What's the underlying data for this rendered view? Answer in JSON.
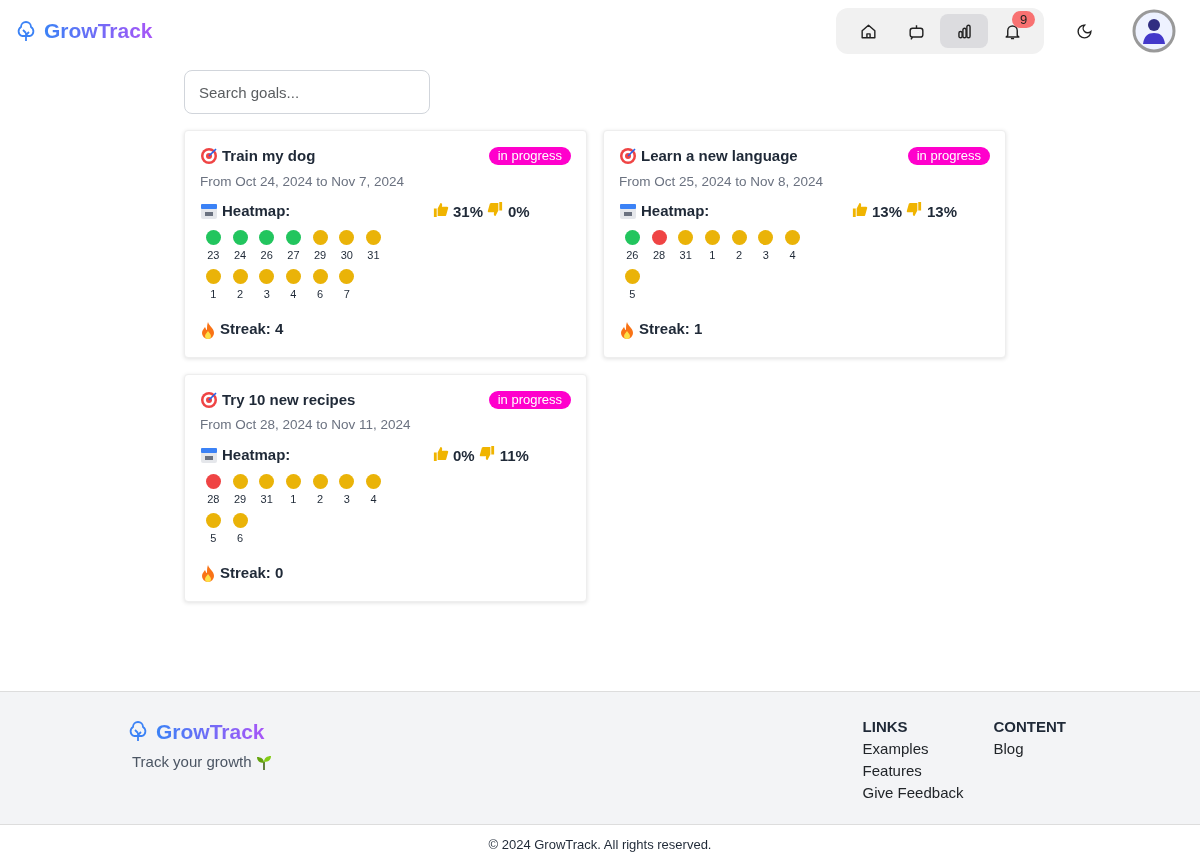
{
  "brand": "GrowTrack",
  "nav": [
    {
      "kind": "home",
      "selected": false
    },
    {
      "kind": "bot",
      "selected": false
    },
    {
      "kind": "chart",
      "selected": true
    },
    {
      "kind": "bell",
      "selected": false,
      "badge": "9"
    }
  ],
  "search": {
    "placeholder": "Search goals..."
  },
  "goals": [
    {
      "title": "Train my dog",
      "status": "in progress",
      "dates": "From Oct 24, 2024 to Nov 7, 2024",
      "heatmap_label": "Heatmap:",
      "up": "31%",
      "down": "0%",
      "streak": "Streak: 4",
      "days": [
        {
          "label": "23",
          "color": "#22c55e"
        },
        {
          "label": "24",
          "color": "#22c55e"
        },
        {
          "label": "26",
          "color": "#22c55e"
        },
        {
          "label": "27",
          "color": "#22c55e"
        },
        {
          "label": "29",
          "color": "#eab308"
        },
        {
          "label": "30",
          "color": "#eab308"
        },
        {
          "label": "31",
          "color": "#eab308"
        },
        {
          "label": "1",
          "color": "#eab308"
        },
        {
          "label": "2",
          "color": "#eab308"
        },
        {
          "label": "3",
          "color": "#eab308"
        },
        {
          "label": "4",
          "color": "#eab308"
        },
        {
          "label": "6",
          "color": "#eab308"
        },
        {
          "label": "7",
          "color": "#eab308"
        }
      ]
    },
    {
      "title": "Learn a new language",
      "status": "in progress",
      "dates": "From Oct 25, 2024 to Nov 8, 2024",
      "heatmap_label": "Heatmap:",
      "up": "13%",
      "down": "13%",
      "streak": "Streak: 1",
      "days": [
        {
          "label": "26",
          "color": "#22c55e"
        },
        {
          "label": "28",
          "color": "#ef4444"
        },
        {
          "label": "31",
          "color": "#eab308"
        },
        {
          "label": "1",
          "color": "#eab308"
        },
        {
          "label": "2",
          "color": "#eab308"
        },
        {
          "label": "3",
          "color": "#eab308"
        },
        {
          "label": "4",
          "color": "#eab308"
        },
        {
          "label": "5",
          "color": "#eab308"
        }
      ]
    },
    {
      "title": "Try 10 new recipes",
      "status": "in progress",
      "dates": "From Oct 28, 2024 to Nov 11, 2024",
      "heatmap_label": "Heatmap:",
      "up": "0%",
      "down": "11%",
      "streak": "Streak: 0",
      "days": [
        {
          "label": "28",
          "color": "#ef4444"
        },
        {
          "label": "29",
          "color": "#eab308"
        },
        {
          "label": "31",
          "color": "#eab308"
        },
        {
          "label": "1",
          "color": "#eab308"
        },
        {
          "label": "2",
          "color": "#eab308"
        },
        {
          "label": "3",
          "color": "#eab308"
        },
        {
          "label": "4",
          "color": "#eab308"
        },
        {
          "label": "5",
          "color": "#eab308"
        },
        {
          "label": "6",
          "color": "#eab308"
        }
      ]
    }
  ],
  "footer": {
    "brand": "GrowTrack",
    "tagline": "Track your growth",
    "columns": [
      {
        "heading": "LINKS",
        "links": [
          "Examples",
          "Features",
          "Give Feedback"
        ]
      },
      {
        "heading": "CONTENT",
        "links": [
          "Blog"
        ]
      }
    ],
    "copyright": "© 2024 GrowTrack. All rights reserved."
  }
}
